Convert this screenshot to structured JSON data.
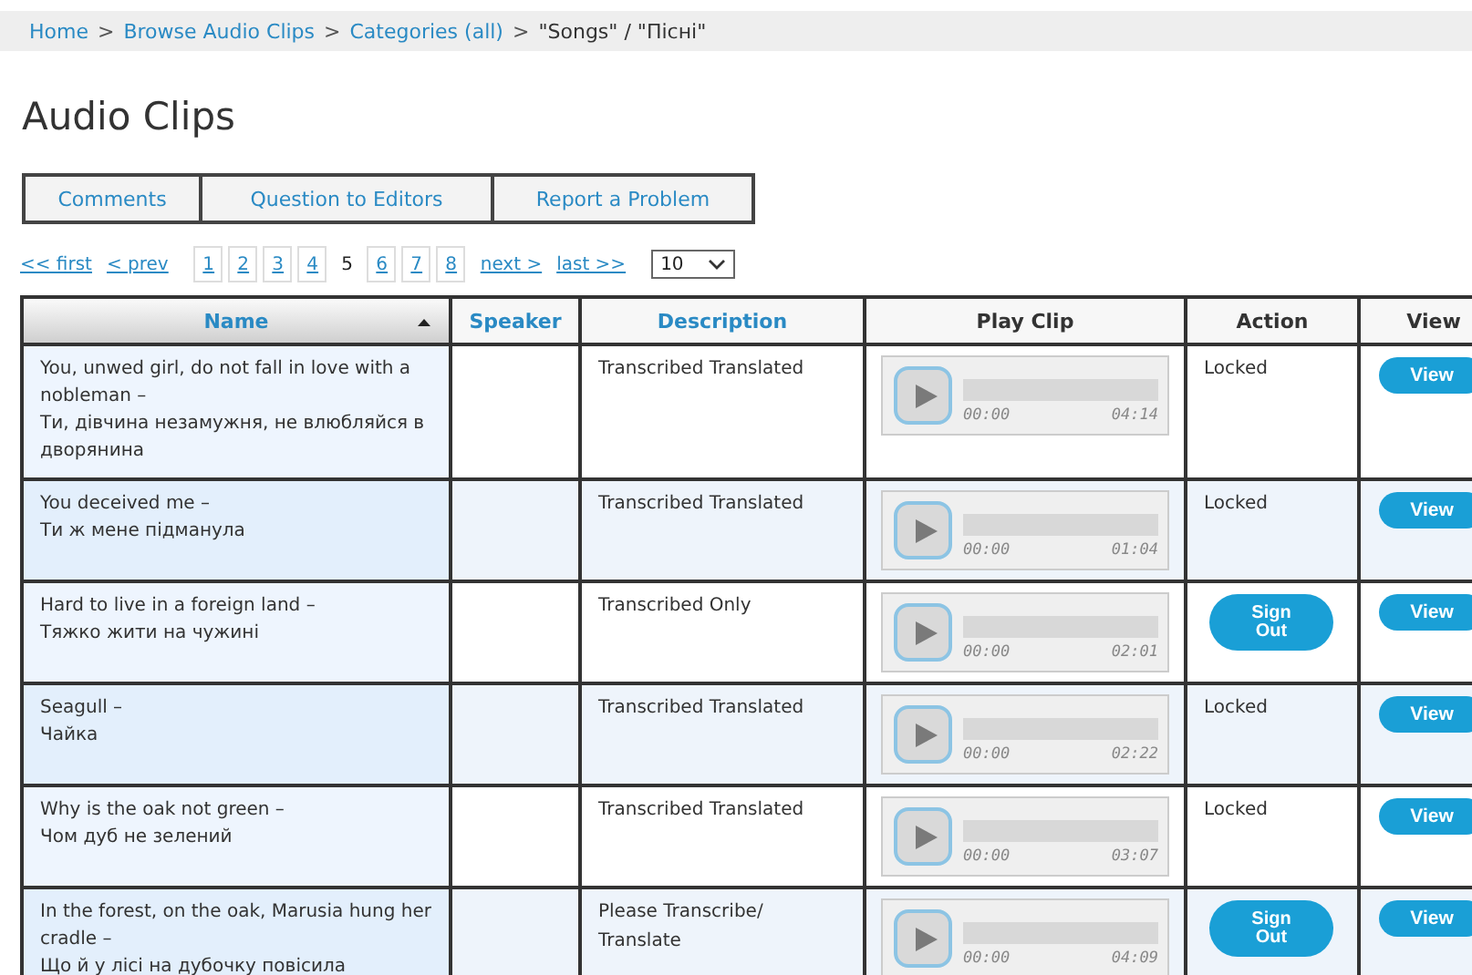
{
  "breadcrumb": [
    {
      "kind": "link",
      "label": "Home"
    },
    {
      "kind": "separator",
      "label": ">"
    },
    {
      "kind": "link",
      "label": "Browse Audio Clips"
    },
    {
      "kind": "separator",
      "label": ">"
    },
    {
      "kind": "link",
      "label": "Categories (all)"
    },
    {
      "kind": "separator",
      "label": ">"
    },
    {
      "kind": "current",
      "label": "\"Songs\" / \"Пісні\""
    }
  ],
  "title": "Audio Clips",
  "tabs": [
    {
      "label": "Comments"
    },
    {
      "label": "Question to Editors"
    },
    {
      "label": "Report a Problem"
    }
  ],
  "pager": {
    "first": "<< first",
    "prev": "< prev",
    "pages": [
      {
        "label": "1",
        "selected": false
      },
      {
        "label": "2",
        "selected": false
      },
      {
        "label": "3",
        "selected": false
      },
      {
        "label": "4",
        "selected": false
      },
      {
        "label": "5",
        "selected": true
      },
      {
        "label": "6",
        "selected": false
      },
      {
        "label": "7",
        "selected": false
      },
      {
        "label": "8",
        "selected": false
      }
    ],
    "next": "next >",
    "last": "last >>",
    "page_size": "10"
  },
  "table": {
    "columns": [
      {
        "label": "Name",
        "sortable": true,
        "sorted": true
      },
      {
        "label": "Speaker",
        "sortable": true,
        "sorted": false
      },
      {
        "label": "Description",
        "sortable": true,
        "sorted": false
      },
      {
        "label": "Play Clip",
        "sortable": false,
        "sorted": false
      },
      {
        "label": "Action",
        "sortable": false,
        "sorted": false
      },
      {
        "label": "View",
        "sortable": false,
        "sorted": false
      }
    ],
    "rows": [
      {
        "name": [
          "You, unwed girl, do not fall in love with a nobleman –",
          "Ти, дівчина незамужня, не влюбляйся в дворянина"
        ],
        "description": "Transcribed Translated",
        "start": "00:00",
        "duration": "04:14",
        "action": {
          "kind": "text",
          "label": "Locked"
        },
        "view": "View"
      },
      {
        "name": [
          "You deceived me –",
          "Ти ж мене підманула"
        ],
        "description": "Transcribed Translated",
        "start": "00:00",
        "duration": "01:04",
        "action": {
          "kind": "text",
          "label": "Locked"
        },
        "view": "View"
      },
      {
        "name": [
          "Hard to live in a foreign land –",
          "Тяжко жити на чужині"
        ],
        "description": "Transcribed Only",
        "start": "00:00",
        "duration": "02:01",
        "action": {
          "kind": "button",
          "label": "Sign Out"
        },
        "view": "View"
      },
      {
        "name": [
          "Seagull –",
          "Чайка"
        ],
        "description": "Transcribed Translated",
        "start": "00:00",
        "duration": "02:22",
        "action": {
          "kind": "text",
          "label": "Locked"
        },
        "view": "View"
      },
      {
        "name": [
          "Why is the oak not green –",
          "Чом дуб не зелений"
        ],
        "description": "Transcribed Translated",
        "start": "00:00",
        "duration": "03:07",
        "action": {
          "kind": "text",
          "label": "Locked"
        },
        "view": "View"
      },
      {
        "name": [
          "In the forest, on the oak, Marusia hung her cradle –",
          "Що й у лісі на дубочку повісила"
        ],
        "description": "Please Transcribe/ Translate",
        "start": "00:00",
        "duration": "04:09",
        "action": {
          "kind": "button",
          "label": "Sign Out"
        },
        "view": "View"
      }
    ]
  }
}
